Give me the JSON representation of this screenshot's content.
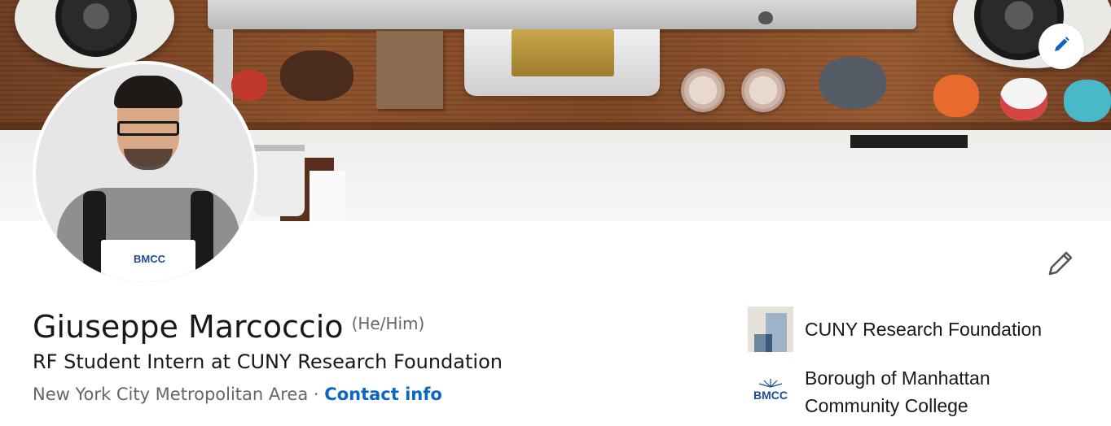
{
  "profile": {
    "name": "Giuseppe Marcoccio",
    "pronouns": "(He/Him)",
    "headline": "RF Student Intern at CUNY Research Foundation",
    "location": "New York City Metropolitan Area",
    "separator": "·",
    "contact_info_label": "Contact info"
  },
  "affiliations": [
    {
      "label": "CUNY Research Foundation",
      "logo": "cuny-research-foundation-logo"
    },
    {
      "label": "Borough of Manhattan Community College",
      "logo": "bmcc-logo"
    }
  ],
  "avatar": {
    "folder_logo_text": "BMCC"
  },
  "bmcc_logo_text": "BMCC",
  "icons": {
    "banner_edit": "pencil-icon",
    "profile_edit": "pencil-icon"
  },
  "colors": {
    "link": "#0a66c2",
    "text_primary": "#191919",
    "text_secondary": "#666666"
  }
}
